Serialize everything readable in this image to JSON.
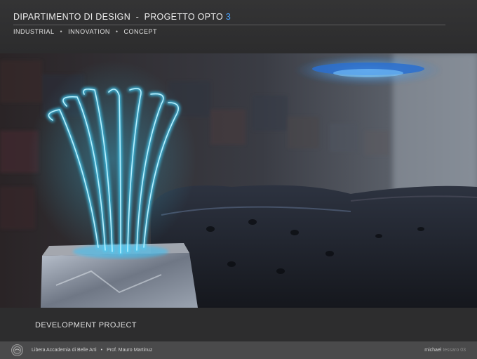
{
  "header": {
    "title_main": "DIPARTIMENTO DI DESIGN  -  PROGETTO OPTO",
    "title_number": "3",
    "tags": [
      "INDUSTRIAL",
      "INNOVATION",
      "CONCEPT"
    ]
  },
  "main": {
    "section_label": "DEVELOPMENT PROJECT"
  },
  "footer": {
    "institution": "Libera Accademia di Belle Arti",
    "professor": "Prof. Mauro Martinuz",
    "author_first": "michael",
    "author_last": "tessaro 03"
  },
  "colors": {
    "accent": "#4aa3ff",
    "lamp_glow": "#3fd4ff"
  }
}
